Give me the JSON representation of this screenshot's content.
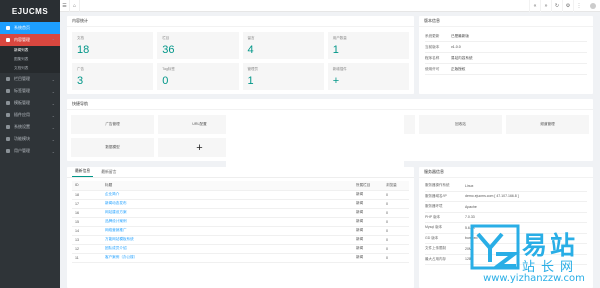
{
  "app": {
    "logo": "EJUCMS"
  },
  "sidebar": {
    "items": [
      {
        "label": "系统首页"
      },
      {
        "label": "内容管理"
      },
      {
        "label": "栏目管理"
      },
      {
        "label": "标签管理"
      },
      {
        "label": "模板管理"
      },
      {
        "label": "插件应用"
      },
      {
        "label": "系统设置"
      },
      {
        "label": "功能模块"
      },
      {
        "label": "用户管理"
      }
    ],
    "sub_items": [
      {
        "label": "新闻列表"
      },
      {
        "label": "图集列表"
      },
      {
        "label": "文档列表"
      }
    ]
  },
  "topbar": {
    "collapse_icon": "menu-icon",
    "home_icon": "home-icon",
    "right_icons": [
      "prev-icon",
      "next-icon",
      "refresh-icon",
      "settings-icon",
      "more-icon"
    ]
  },
  "stats": {
    "title": "内容统计",
    "cards": [
      {
        "label": "文档",
        "value": "18"
      },
      {
        "label": "栏目",
        "value": "36"
      },
      {
        "label": "留言",
        "value": "4"
      },
      {
        "label": "用户数量",
        "value": "1"
      },
      {
        "label": "广告",
        "value": "3"
      },
      {
        "label": "Tag标签",
        "value": "0"
      },
      {
        "label": "管理员",
        "value": "1"
      },
      {
        "label": "新增插件",
        "value": "+"
      }
    ]
  },
  "sysinfo": {
    "title": "版本信息",
    "rows": [
      {
        "key": "系统更新",
        "value": "已是最新版"
      },
      {
        "key": "当前版本",
        "value": "v1.0.0"
      },
      {
        "key": "程序名称",
        "value": "易站内容系统"
      },
      {
        "key": "使用许可",
        "value": "正版授权"
      }
    ]
  },
  "quick": {
    "title": "快捷导航",
    "buttons": [
      {
        "label": "广告管理"
      },
      {
        "label": "URL配置"
      },
      {
        "label": ""
      },
      {
        "label": "栏目管理"
      },
      {
        "label": "回收站"
      },
      {
        "label": "频道管理"
      },
      {
        "label": "数据模型"
      }
    ],
    "add": "+"
  },
  "content": {
    "tabs": [
      {
        "label": "最新信息"
      },
      {
        "label": "最新留言"
      }
    ],
    "columns": [
      "ID",
      "标题",
      "所属栏目",
      "浏览量"
    ],
    "rows": [
      {
        "id": "18",
        "title": "企业简介",
        "col": "新闻",
        "views": "0"
      },
      {
        "id": "17",
        "title": "新闻动态发布",
        "col": "新闻",
        "views": "0"
      },
      {
        "id": "16",
        "title": "网站建设方案",
        "col": "新闻",
        "views": "0"
      },
      {
        "id": "15",
        "title": "品牌设计案例",
        "col": "新闻",
        "views": "0"
      },
      {
        "id": "14",
        "title": "网络营销推广",
        "col": "新闻",
        "views": "0"
      },
      {
        "id": "13",
        "title": "万能网站模板系统",
        "col": "新闻",
        "views": "0"
      },
      {
        "id": "12",
        "title": "团队成员介绍",
        "col": "新闻",
        "views": "0"
      },
      {
        "id": "11",
        "title": "客户案例（办公楼）",
        "col": "新闻",
        "views": "0"
      }
    ]
  },
  "server": {
    "title": "服务器信息",
    "rows": [
      {
        "key": "服务器操作系统",
        "value": "Linux"
      },
      {
        "key": "服务器域名/IP",
        "value": "demo.ejucms.com [ 47.107.166.8 ]"
      },
      {
        "key": "服务器环境",
        "value": "Apache"
      },
      {
        "key": "PHP 版本",
        "value": "7.0.33"
      },
      {
        "key": "Mysql 版本",
        "value": "5.6.48"
      },
      {
        "key": "GD 版本",
        "value": "bundled"
      },
      {
        "key": "文件上传限制",
        "value": "20M"
      },
      {
        "key": "最大占用内存",
        "value": "128M"
      }
    ]
  },
  "watermark": {
    "brand": "易站",
    "sub": "站长网",
    "url": "www.yizhanzzw.com",
    "color": "#29aee6"
  }
}
